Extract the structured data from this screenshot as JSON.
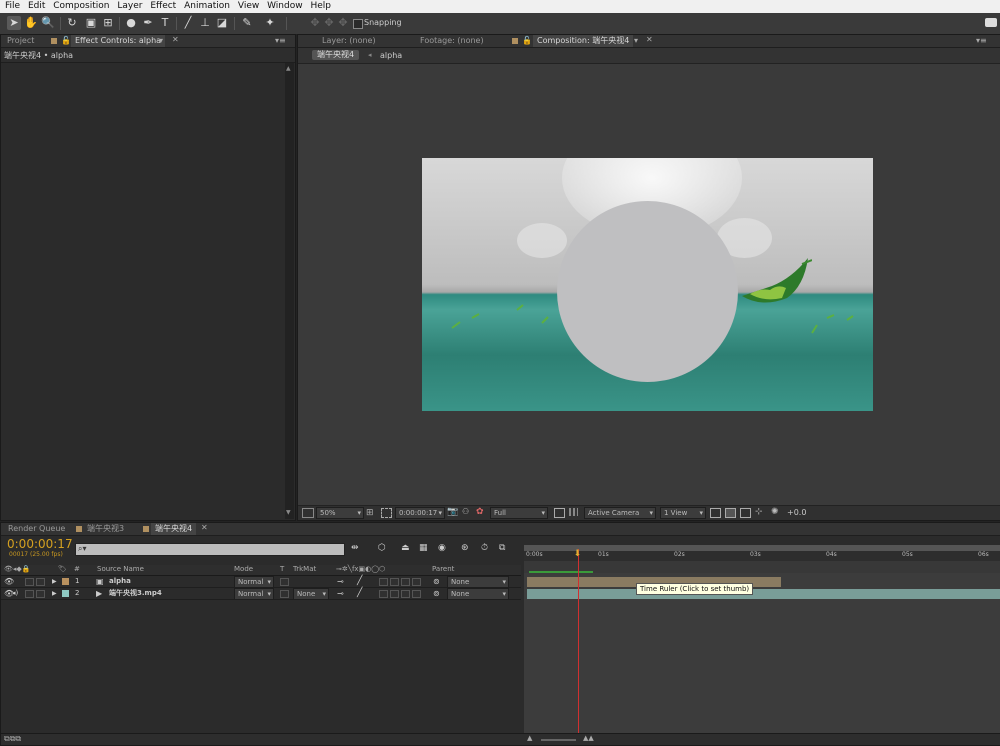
{
  "menu": [
    "File",
    "Edit",
    "Composition",
    "Layer",
    "Effect",
    "Animation",
    "View",
    "Window",
    "Help"
  ],
  "toolbar": {
    "snapping_label": "Snapping",
    "snapping_checked": false
  },
  "project_panel": {
    "tabs": [
      {
        "label": "Project"
      },
      {
        "label": "Effect Controls: alpha"
      }
    ],
    "breadcrumb": "端午央视4 • alpha"
  },
  "viewer": {
    "tabs": [
      {
        "label": "Layer: (none)"
      },
      {
        "label": "Footage: (none)"
      },
      {
        "label": "Composition: 端午央视4"
      }
    ],
    "comp_tabs": [
      {
        "label": "端午央视4"
      },
      {
        "label": "alpha"
      }
    ],
    "footer": {
      "zoom": "50%",
      "timecode": "0:00:00:17",
      "resolution": "Full",
      "camera": "Active Camera",
      "views": "1 View",
      "exposure": "+0.0"
    }
  },
  "timeline": {
    "tabs": [
      {
        "label": "Render Queue"
      },
      {
        "label": "端午央视3"
      },
      {
        "label": "端午央视4"
      }
    ],
    "timecode": "0:00:00:17",
    "timecode_sub": "00017 (25.00 fps)",
    "search_placeholder": "",
    "columns": {
      "num": "#",
      "source": "Source Name",
      "mode": "Mode",
      "t": "T",
      "trkmat": "TrkMat",
      "parent": "Parent"
    },
    "layers": [
      {
        "num": "1",
        "name": "alpha",
        "mode": "Normal",
        "trkmat": "",
        "parent": "None",
        "color": "#b9915f"
      },
      {
        "num": "2",
        "name": "端午央视3.mp4",
        "mode": "Normal",
        "trkmat": "None",
        "parent": "None",
        "color": "#8fc9c2"
      }
    ],
    "ruler_labels": [
      "0:00s",
      "01s",
      "02s",
      "03s",
      "04s",
      "05s",
      "06s"
    ],
    "tooltip": "Time Ruler (Click to set thumb)",
    "playhead_seconds": 0.68
  },
  "colors": {
    "timecode": "#d4a020",
    "accent": "#e0b030"
  }
}
